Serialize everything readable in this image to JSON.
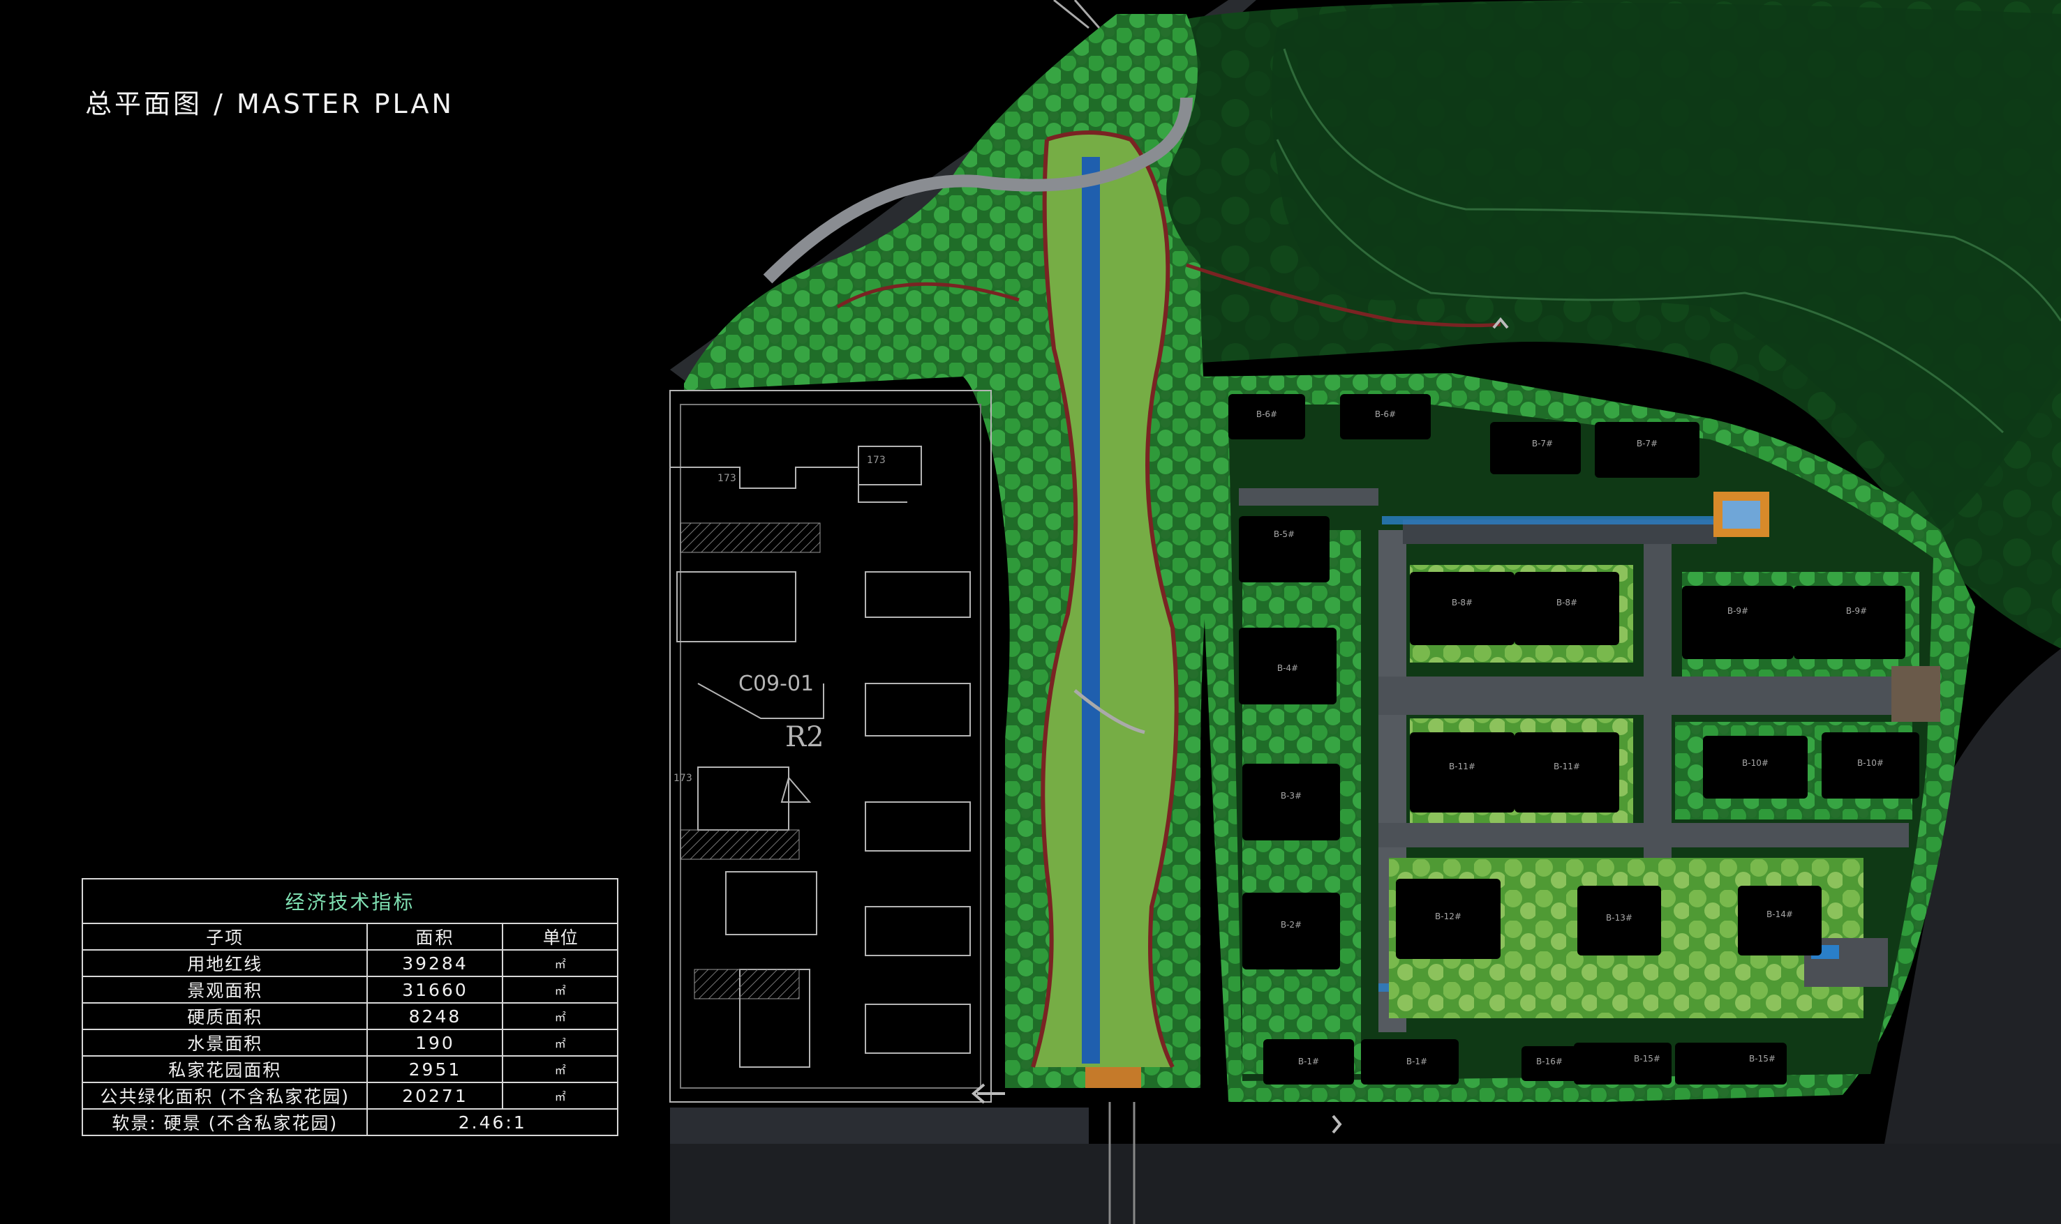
{
  "title": "总平面图 / MASTER PLAN",
  "colors": {
    "background": "#000000",
    "lawn": "#0d3a16",
    "park_green": "#2d7a2a",
    "light_green": "#6fb548",
    "tree_green": "#2f9a3a",
    "water": "#1f5fae",
    "building": "#000000",
    "road": "#2a2d33",
    "river": "#202226",
    "path_red": "#7a2323",
    "accent_orange": "#d88a2a"
  },
  "map": {
    "site_label": "C09-01",
    "zone_label": "R2",
    "neighbor_labels": [
      "173",
      "173",
      "173"
    ],
    "buildings": [
      {
        "id": "b6",
        "labels": [
          "B-6#",
          "B-6#"
        ]
      },
      {
        "id": "b7",
        "labels": [
          "B-7#",
          "B-7#"
        ]
      },
      {
        "id": "b5",
        "labels": [
          "B-5#"
        ]
      },
      {
        "id": "b8",
        "labels": [
          "B-8#",
          "B-8#"
        ]
      },
      {
        "id": "b9",
        "labels": [
          "B-9#",
          "B-9#"
        ]
      },
      {
        "id": "b4",
        "labels": [
          "B-4#"
        ]
      },
      {
        "id": "b11",
        "labels": [
          "B-11#",
          "B-11#"
        ]
      },
      {
        "id": "b10",
        "labels": [
          "B-10#",
          "B-10#"
        ]
      },
      {
        "id": "b3",
        "labels": [
          "B-3#"
        ]
      },
      {
        "id": "b12",
        "labels": [
          "B-12#"
        ]
      },
      {
        "id": "b13",
        "labels": [
          "B-13#"
        ]
      },
      {
        "id": "b14",
        "labels": [
          "B-14#"
        ]
      },
      {
        "id": "b2",
        "labels": [
          "B-2#"
        ]
      },
      {
        "id": "b1",
        "labels": [
          "B-1#",
          "B-1#"
        ]
      },
      {
        "id": "b16",
        "labels": [
          "B-16#"
        ]
      },
      {
        "id": "b15",
        "labels": [
          "B-15#",
          "B-15#"
        ]
      }
    ]
  },
  "table": {
    "caption": "经济技术指标",
    "headers": {
      "item": "子项",
      "area": "面积",
      "unit": "单位"
    },
    "rows": [
      {
        "item": "用地红线",
        "area": "39284",
        "unit": "㎡"
      },
      {
        "item": "景观面积",
        "area": "31660",
        "unit": "㎡"
      },
      {
        "item": "硬质面积",
        "area": "8248",
        "unit": "㎡"
      },
      {
        "item": "水景面积",
        "area": "190",
        "unit": "㎡"
      },
      {
        "item": "私家花园面积",
        "area": "2951",
        "unit": "㎡"
      },
      {
        "item": "公共绿化面积 (不含私家花园)",
        "area": "20271",
        "unit": "㎡"
      }
    ],
    "ratio": {
      "item": "软景: 硬景 (不含私家花园)",
      "value": "2.46:1"
    }
  }
}
